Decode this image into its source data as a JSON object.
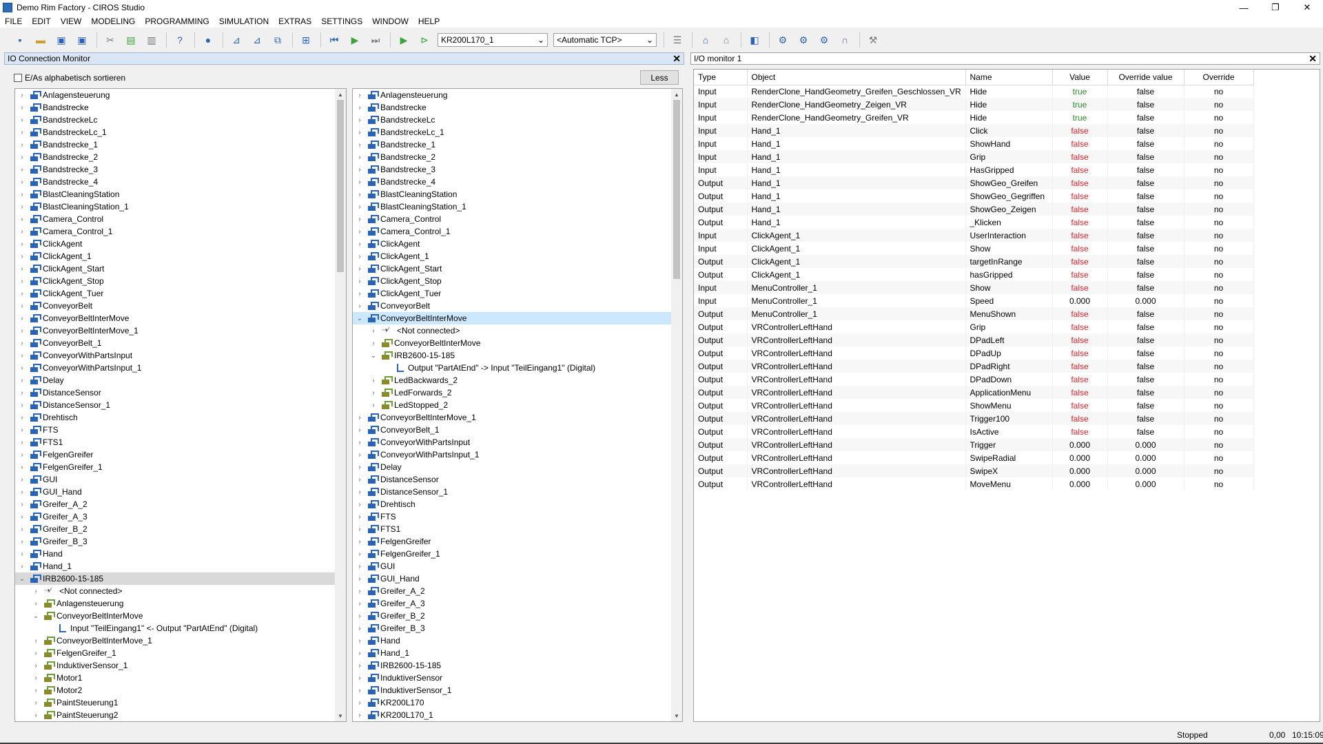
{
  "window": {
    "title": "Demo Rim Factory - CIROS Studio",
    "min": "—",
    "max": "❐",
    "close": "✕"
  },
  "menu": [
    "FILE",
    "EDIT",
    "VIEW",
    "MODELING",
    "PROGRAMMING",
    "SIMULATION",
    "EXTRAS",
    "SETTINGS",
    "WINDOW",
    "HELP"
  ],
  "toolbar": {
    "robot_select": "KR200L170_1",
    "tcp_select": "<Automatic TCP>"
  },
  "left_panel": {
    "title": "IO Connection Monitor",
    "sort_label": "E/As alphabetisch sortieren",
    "less_button": "Less",
    "tree1": [
      {
        "label": "Anlagensteuerung",
        "lvl": 0,
        "caret": ">",
        "icon": "blue"
      },
      {
        "label": "Bandstrecke",
        "lvl": 0,
        "caret": ">",
        "icon": "blue"
      },
      {
        "label": "BandstreckeLc",
        "lvl": 0,
        "caret": ">",
        "icon": "blue"
      },
      {
        "label": "BandstreckeLc_1",
        "lvl": 0,
        "caret": ">",
        "icon": "blue"
      },
      {
        "label": "Bandstrecke_1",
        "lvl": 0,
        "caret": ">",
        "icon": "blue"
      },
      {
        "label": "Bandstrecke_2",
        "lvl": 0,
        "caret": ">",
        "icon": "blue"
      },
      {
        "label": "Bandstrecke_3",
        "lvl": 0,
        "caret": ">",
        "icon": "blue"
      },
      {
        "label": "Bandstrecke_4",
        "lvl": 0,
        "caret": ">",
        "icon": "blue"
      },
      {
        "label": "BlastCleaningStation",
        "lvl": 0,
        "caret": ">",
        "icon": "blue"
      },
      {
        "label": "BlastCleaningStation_1",
        "lvl": 0,
        "caret": ">",
        "icon": "blue"
      },
      {
        "label": "Camera_Control",
        "lvl": 0,
        "caret": ">",
        "icon": "blue"
      },
      {
        "label": "Camera_Control_1",
        "lvl": 0,
        "caret": ">",
        "icon": "blue"
      },
      {
        "label": "ClickAgent",
        "lvl": 0,
        "caret": ">",
        "icon": "blue"
      },
      {
        "label": "ClickAgent_1",
        "lvl": 0,
        "caret": ">",
        "icon": "blue"
      },
      {
        "label": "ClickAgent_Start",
        "lvl": 0,
        "caret": ">",
        "icon": "blue"
      },
      {
        "label": "ClickAgent_Stop",
        "lvl": 0,
        "caret": ">",
        "icon": "blue"
      },
      {
        "label": "ClickAgent_Tuer",
        "lvl": 0,
        "caret": ">",
        "icon": "blue"
      },
      {
        "label": "ConveyorBelt",
        "lvl": 0,
        "caret": ">",
        "icon": "blue"
      },
      {
        "label": "ConveyorBeltInterMove",
        "lvl": 0,
        "caret": ">",
        "icon": "blue"
      },
      {
        "label": "ConveyorBeltInterMove_1",
        "lvl": 0,
        "caret": ">",
        "icon": "blue"
      },
      {
        "label": "ConveyorBelt_1",
        "lvl": 0,
        "caret": ">",
        "icon": "blue"
      },
      {
        "label": "ConveyorWithPartsInput",
        "lvl": 0,
        "caret": ">",
        "icon": "blue"
      },
      {
        "label": "ConveyorWithPartsInput_1",
        "lvl": 0,
        "caret": ">",
        "icon": "blue"
      },
      {
        "label": "Delay",
        "lvl": 0,
        "caret": ">",
        "icon": "blue"
      },
      {
        "label": "DistanceSensor",
        "lvl": 0,
        "caret": ">",
        "icon": "blue"
      },
      {
        "label": "DistanceSensor_1",
        "lvl": 0,
        "caret": ">",
        "icon": "blue"
      },
      {
        "label": "Drehtisch",
        "lvl": 0,
        "caret": ">",
        "icon": "blue"
      },
      {
        "label": "FTS",
        "lvl": 0,
        "caret": ">",
        "icon": "blue"
      },
      {
        "label": "FTS1",
        "lvl": 0,
        "caret": ">",
        "icon": "blue"
      },
      {
        "label": "FelgenGreifer",
        "lvl": 0,
        "caret": ">",
        "icon": "blue"
      },
      {
        "label": "FelgenGreifer_1",
        "lvl": 0,
        "caret": ">",
        "icon": "blue"
      },
      {
        "label": "GUI",
        "lvl": 0,
        "caret": ">",
        "icon": "blue"
      },
      {
        "label": "GUI_Hand",
        "lvl": 0,
        "caret": ">",
        "icon": "blue"
      },
      {
        "label": "Greifer_A_2",
        "lvl": 0,
        "caret": ">",
        "icon": "blue"
      },
      {
        "label": "Greifer_A_3",
        "lvl": 0,
        "caret": ">",
        "icon": "blue"
      },
      {
        "label": "Greifer_B_2",
        "lvl": 0,
        "caret": ">",
        "icon": "blue"
      },
      {
        "label": "Greifer_B_3",
        "lvl": 0,
        "caret": ">",
        "icon": "blue"
      },
      {
        "label": "Hand",
        "lvl": 0,
        "caret": ">",
        "icon": "blue"
      },
      {
        "label": "Hand_1",
        "lvl": 0,
        "caret": ">",
        "icon": "blue"
      },
      {
        "label": "IRB2600-15-185",
        "lvl": 0,
        "caret": "v",
        "icon": "blue",
        "hl": true
      },
      {
        "label": "<Not connected>",
        "lvl": 1,
        "caret": ">",
        "icon": "link"
      },
      {
        "label": "Anlagensteuerung",
        "lvl": 1,
        "caret": ">",
        "icon": "olive"
      },
      {
        "label": "ConveyorBeltInterMove",
        "lvl": 1,
        "caret": "v",
        "icon": "olive"
      },
      {
        "label": "Input \"TeilEingang1\" <- Output \"PartAtEnd\" (Digital)",
        "lvl": 2,
        "caret": "",
        "icon": "conn"
      },
      {
        "label": "ConveyorBeltInterMove_1",
        "lvl": 1,
        "caret": ">",
        "icon": "olive"
      },
      {
        "label": "FelgenGreifer_1",
        "lvl": 1,
        "caret": ">",
        "icon": "olive"
      },
      {
        "label": "InduktiverSensor_1",
        "lvl": 1,
        "caret": ">",
        "icon": "olive"
      },
      {
        "label": "Motor1",
        "lvl": 1,
        "caret": ">",
        "icon": "olive"
      },
      {
        "label": "Motor2",
        "lvl": 1,
        "caret": ">",
        "icon": "olive"
      },
      {
        "label": "PaintSteuerung1",
        "lvl": 1,
        "caret": ">",
        "icon": "olive"
      },
      {
        "label": "PaintSteuerung2",
        "lvl": 1,
        "caret": ">",
        "icon": "olive"
      }
    ],
    "tree2": [
      {
        "label": "Anlagensteuerung",
        "lvl": 0,
        "caret": ">",
        "icon": "blue"
      },
      {
        "label": "Bandstrecke",
        "lvl": 0,
        "caret": ">",
        "icon": "blue"
      },
      {
        "label": "BandstreckeLc",
        "lvl": 0,
        "caret": ">",
        "icon": "blue"
      },
      {
        "label": "BandstreckeLc_1",
        "lvl": 0,
        "caret": ">",
        "icon": "blue"
      },
      {
        "label": "Bandstrecke_1",
        "lvl": 0,
        "caret": ">",
        "icon": "blue"
      },
      {
        "label": "Bandstrecke_2",
        "lvl": 0,
        "caret": ">",
        "icon": "blue"
      },
      {
        "label": "Bandstrecke_3",
        "lvl": 0,
        "caret": ">",
        "icon": "blue"
      },
      {
        "label": "Bandstrecke_4",
        "lvl": 0,
        "caret": ">",
        "icon": "blue"
      },
      {
        "label": "BlastCleaningStation",
        "lvl": 0,
        "caret": ">",
        "icon": "blue"
      },
      {
        "label": "BlastCleaningStation_1",
        "lvl": 0,
        "caret": ">",
        "icon": "blue"
      },
      {
        "label": "Camera_Control",
        "lvl": 0,
        "caret": ">",
        "icon": "blue"
      },
      {
        "label": "Camera_Control_1",
        "lvl": 0,
        "caret": ">",
        "icon": "blue"
      },
      {
        "label": "ClickAgent",
        "lvl": 0,
        "caret": ">",
        "icon": "blue"
      },
      {
        "label": "ClickAgent_1",
        "lvl": 0,
        "caret": ">",
        "icon": "blue"
      },
      {
        "label": "ClickAgent_Start",
        "lvl": 0,
        "caret": ">",
        "icon": "blue"
      },
      {
        "label": "ClickAgent_Stop",
        "lvl": 0,
        "caret": ">",
        "icon": "blue"
      },
      {
        "label": "ClickAgent_Tuer",
        "lvl": 0,
        "caret": ">",
        "icon": "blue"
      },
      {
        "label": "ConveyorBelt",
        "lvl": 0,
        "caret": ">",
        "icon": "blue"
      },
      {
        "label": "ConveyorBeltInterMove",
        "lvl": 0,
        "caret": "v",
        "icon": "blue",
        "sel": true
      },
      {
        "label": "<Not connected>",
        "lvl": 1,
        "caret": ">",
        "icon": "link"
      },
      {
        "label": "ConveyorBeltInterMove",
        "lvl": 1,
        "caret": ">",
        "icon": "olive"
      },
      {
        "label": "IRB2600-15-185",
        "lvl": 1,
        "caret": "v",
        "icon": "olive"
      },
      {
        "label": "Output \"PartAtEnd\" -> Input \"TeilEingang1\" (Digital)",
        "lvl": 2,
        "caret": "",
        "icon": "conn"
      },
      {
        "label": "LedBackwards_2",
        "lvl": 1,
        "caret": ">",
        "icon": "olive"
      },
      {
        "label": "LedForwards_2",
        "lvl": 1,
        "caret": ">",
        "icon": "olive"
      },
      {
        "label": "LedStopped_2",
        "lvl": 1,
        "caret": ">",
        "icon": "olive"
      },
      {
        "label": "ConveyorBeltInterMove_1",
        "lvl": 0,
        "caret": ">",
        "icon": "blue"
      },
      {
        "label": "ConveyorBelt_1",
        "lvl": 0,
        "caret": ">",
        "icon": "blue"
      },
      {
        "label": "ConveyorWithPartsInput",
        "lvl": 0,
        "caret": ">",
        "icon": "blue"
      },
      {
        "label": "ConveyorWithPartsInput_1",
        "lvl": 0,
        "caret": ">",
        "icon": "blue"
      },
      {
        "label": "Delay",
        "lvl": 0,
        "caret": ">",
        "icon": "blue"
      },
      {
        "label": "DistanceSensor",
        "lvl": 0,
        "caret": ">",
        "icon": "blue"
      },
      {
        "label": "DistanceSensor_1",
        "lvl": 0,
        "caret": ">",
        "icon": "blue"
      },
      {
        "label": "Drehtisch",
        "lvl": 0,
        "caret": ">",
        "icon": "blue"
      },
      {
        "label": "FTS",
        "lvl": 0,
        "caret": ">",
        "icon": "blue"
      },
      {
        "label": "FTS1",
        "lvl": 0,
        "caret": ">",
        "icon": "blue"
      },
      {
        "label": "FelgenGreifer",
        "lvl": 0,
        "caret": ">",
        "icon": "blue"
      },
      {
        "label": "FelgenGreifer_1",
        "lvl": 0,
        "caret": ">",
        "icon": "blue"
      },
      {
        "label": "GUI",
        "lvl": 0,
        "caret": ">",
        "icon": "blue"
      },
      {
        "label": "GUI_Hand",
        "lvl": 0,
        "caret": ">",
        "icon": "blue"
      },
      {
        "label": "Greifer_A_2",
        "lvl": 0,
        "caret": ">",
        "icon": "blue"
      },
      {
        "label": "Greifer_A_3",
        "lvl": 0,
        "caret": ">",
        "icon": "blue"
      },
      {
        "label": "Greifer_B_2",
        "lvl": 0,
        "caret": ">",
        "icon": "blue"
      },
      {
        "label": "Greifer_B_3",
        "lvl": 0,
        "caret": ">",
        "icon": "blue"
      },
      {
        "label": "Hand",
        "lvl": 0,
        "caret": ">",
        "icon": "blue"
      },
      {
        "label": "Hand_1",
        "lvl": 0,
        "caret": ">",
        "icon": "blue"
      },
      {
        "label": "IRB2600-15-185",
        "lvl": 0,
        "caret": ">",
        "icon": "blue"
      },
      {
        "label": "InduktiverSensor",
        "lvl": 0,
        "caret": ">",
        "icon": "blue"
      },
      {
        "label": "InduktiverSensor_1",
        "lvl": 0,
        "caret": ">",
        "icon": "blue"
      },
      {
        "label": "KR200L170",
        "lvl": 0,
        "caret": ">",
        "icon": "blue"
      },
      {
        "label": "KR200L170_1",
        "lvl": 0,
        "caret": ">",
        "icon": "blue"
      }
    ]
  },
  "right_panel": {
    "title": "I/O monitor 1",
    "columns": [
      "Type",
      "Object",
      "Name",
      "Value",
      "Override value",
      "Override"
    ],
    "rows": [
      [
        "Input",
        "RenderClone_HandGeometry_Greifen_Geschlossen_VR",
        "Hide",
        "true",
        "false",
        "no"
      ],
      [
        "Input",
        "RenderClone_HandGeometry_Zeigen_VR",
        "Hide",
        "true",
        "false",
        "no"
      ],
      [
        "Input",
        "RenderClone_HandGeometry_Greifen_VR",
        "Hide",
        "true",
        "false",
        "no"
      ],
      [
        "Input",
        "Hand_1",
        "Click",
        "false",
        "false",
        "no"
      ],
      [
        "Input",
        "Hand_1",
        "ShowHand",
        "false",
        "false",
        "no"
      ],
      [
        "Input",
        "Hand_1",
        "Grip",
        "false",
        "false",
        "no"
      ],
      [
        "Input",
        "Hand_1",
        "HasGripped",
        "false",
        "false",
        "no"
      ],
      [
        "Output",
        "Hand_1",
        "ShowGeo_Greifen",
        "false",
        "false",
        "no"
      ],
      [
        "Output",
        "Hand_1",
        "ShowGeo_Gegriffen",
        "false",
        "false",
        "no"
      ],
      [
        "Output",
        "Hand_1",
        "ShowGeo_Zeigen",
        "false",
        "false",
        "no"
      ],
      [
        "Output",
        "Hand_1",
        "_Klicken",
        "false",
        "false",
        "no"
      ],
      [
        "Input",
        "ClickAgent_1",
        "UserInteraction",
        "false",
        "false",
        "no"
      ],
      [
        "Input",
        "ClickAgent_1",
        "Show",
        "false",
        "false",
        "no"
      ],
      [
        "Output",
        "ClickAgent_1",
        "targetInRange",
        "false",
        "false",
        "no"
      ],
      [
        "Output",
        "ClickAgent_1",
        "hasGripped",
        "false",
        "false",
        "no"
      ],
      [
        "Input",
        "MenuController_1",
        "Show",
        "false",
        "false",
        "no"
      ],
      [
        "Input",
        "MenuController_1",
        "Speed",
        "0.000",
        "0.000",
        "no"
      ],
      [
        "Output",
        "MenuController_1",
        "MenuShown",
        "false",
        "false",
        "no"
      ],
      [
        "Output",
        "VRControllerLeftHand",
        "Grip",
        "false",
        "false",
        "no"
      ],
      [
        "Output",
        "VRControllerLeftHand",
        "DPadLeft",
        "false",
        "false",
        "no"
      ],
      [
        "Output",
        "VRControllerLeftHand",
        "DPadUp",
        "false",
        "false",
        "no"
      ],
      [
        "Output",
        "VRControllerLeftHand",
        "DPadRight",
        "false",
        "false",
        "no"
      ],
      [
        "Output",
        "VRControllerLeftHand",
        "DPadDown",
        "false",
        "false",
        "no"
      ],
      [
        "Output",
        "VRControllerLeftHand",
        "ApplicationMenu",
        "false",
        "false",
        "no"
      ],
      [
        "Output",
        "VRControllerLeftHand",
        "ShowMenu",
        "false",
        "false",
        "no"
      ],
      [
        "Output",
        "VRControllerLeftHand",
        "Trigger100",
        "false",
        "false",
        "no"
      ],
      [
        "Output",
        "VRControllerLeftHand",
        "IsActive",
        "false",
        "false",
        "no"
      ],
      [
        "Output",
        "VRControllerLeftHand",
        "Trigger",
        "0.000",
        "0.000",
        "no"
      ],
      [
        "Output",
        "VRControllerLeftHand",
        "SwipeRadial",
        "0.000",
        "0.000",
        "no"
      ],
      [
        "Output",
        "VRControllerLeftHand",
        "SwipeX",
        "0.000",
        "0.000",
        "no"
      ],
      [
        "Output",
        "VRControllerLeftHand",
        "MoveMenu",
        "0.000",
        "0.000",
        "no"
      ]
    ]
  },
  "status": {
    "state": "Stopped",
    "value": "0,00",
    "time": "10:15:09"
  }
}
